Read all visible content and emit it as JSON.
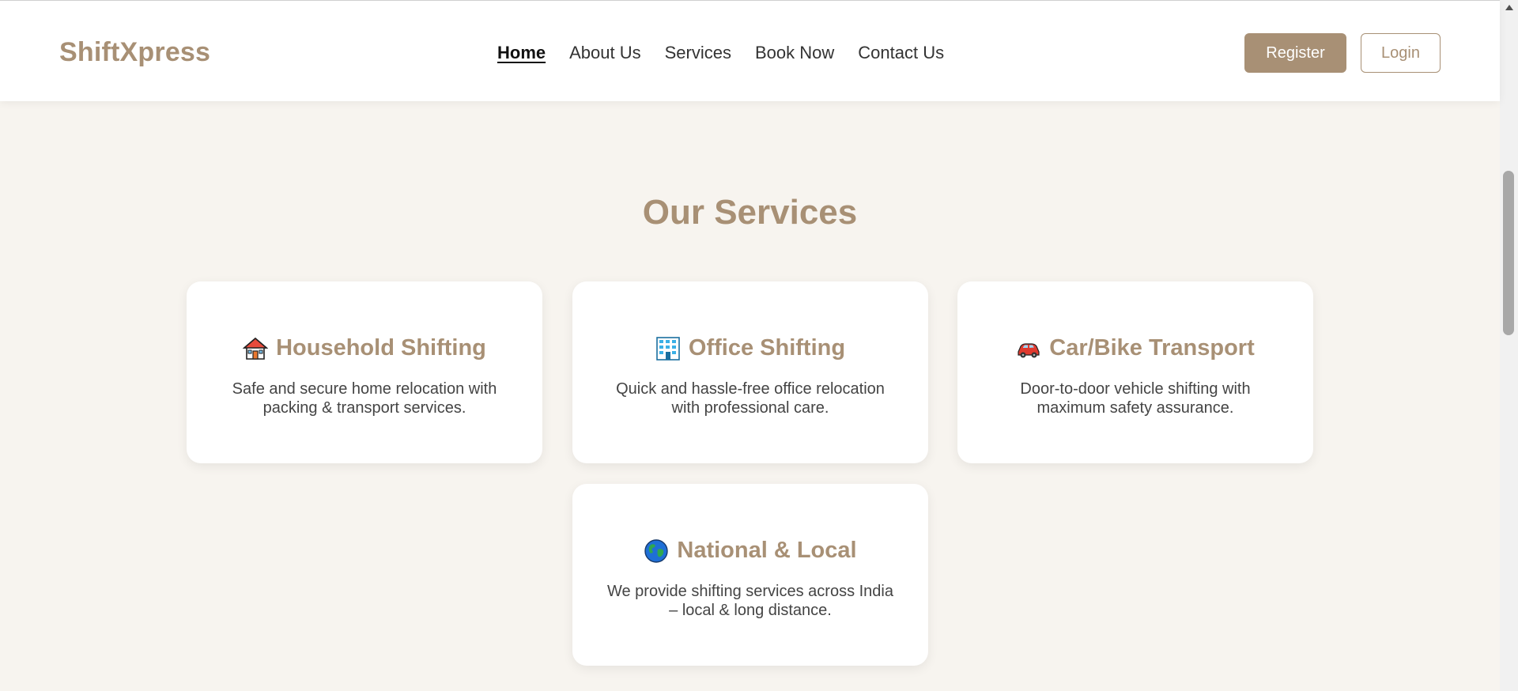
{
  "header": {
    "logo": "ShiftXpress",
    "nav": [
      {
        "label": "Home",
        "active": true
      },
      {
        "label": "About Us"
      },
      {
        "label": "Services"
      },
      {
        "label": "Book Now"
      },
      {
        "label": "Contact Us"
      }
    ],
    "register_label": "Register",
    "login_label": "Login"
  },
  "services": {
    "title": "Our Services",
    "cards": [
      {
        "icon": "house-icon",
        "title": "Household Shifting",
        "desc": "Safe and secure home relocation with packing & transport services."
      },
      {
        "icon": "office-building-icon",
        "title": "Office Shifting",
        "desc": "Quick and hassle-free office relocation with professional care."
      },
      {
        "icon": "car-icon",
        "title": "Car/Bike Transport",
        "desc": "Door-to-door vehicle shifting with maximum safety assurance."
      },
      {
        "icon": "globe-icon",
        "title": "National & Local",
        "desc": "We provide shifting services across India – local & long distance."
      }
    ]
  },
  "colors": {
    "brand": "#a89075",
    "background": "#f7f4ef",
    "card": "#ffffff"
  }
}
